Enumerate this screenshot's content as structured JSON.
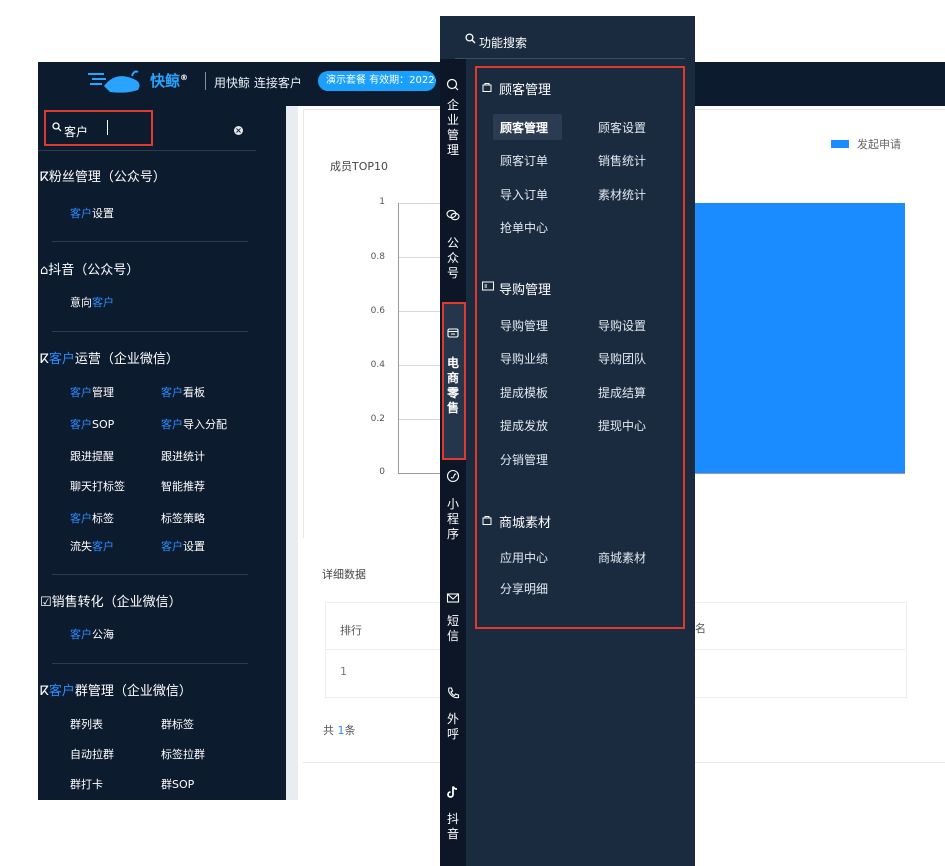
{
  "header": {
    "logo_text": "快鲸",
    "logo_reg": "®",
    "slogan": "用快鲸 连接客户",
    "plan_badge": "演示套餐 有效期：2022-"
  },
  "sidebar": {
    "search": {
      "value_hl": "客户"
    },
    "groups": [
      {
        "title_pre": "粉丝管理（公众号）",
        "items": [
          {
            "pre": "",
            "hl": "客户",
            "post": "设置"
          }
        ]
      },
      {
        "title_pre": "抖音（公众号）",
        "items": [
          {
            "pre": "意向",
            "hl": "客户",
            "post": ""
          }
        ]
      },
      {
        "title_hl": "客户",
        "title_post": "运营（企业微信）",
        "items": [
          {
            "pre": "",
            "hl": "客户",
            "post": "管理"
          },
          {
            "pre": "",
            "hl": "客户",
            "post": "看板"
          },
          {
            "pre": "",
            "hl": "客户",
            "post": "SOP"
          },
          {
            "pre": "",
            "hl": "客户",
            "post": "导入分配"
          },
          {
            "pre": "跟进提醒",
            "hl": "",
            "post": ""
          },
          {
            "pre": "跟进统计",
            "hl": "",
            "post": ""
          },
          {
            "pre": "聊天打标签",
            "hl": "",
            "post": ""
          },
          {
            "pre": "智能推荐",
            "hl": "",
            "post": ""
          },
          {
            "pre": "",
            "hl": "客户",
            "post": "标签"
          },
          {
            "pre": "标签策略",
            "hl": "",
            "post": ""
          },
          {
            "pre": "流失",
            "hl": "客户",
            "post": ""
          },
          {
            "pre": "",
            "hl": "客户",
            "post": "设置"
          }
        ]
      },
      {
        "title_pre": "销售转化（企业微信）",
        "items": [
          {
            "pre": "",
            "hl": "客户",
            "post": "公海"
          }
        ]
      },
      {
        "title_hl": "客户",
        "title_post": "群管理（企业微信）",
        "items": [
          {
            "pre": "群列表",
            "hl": "",
            "post": ""
          },
          {
            "pre": "群标签",
            "hl": "",
            "post": ""
          },
          {
            "pre": "自动拉群",
            "hl": "",
            "post": ""
          },
          {
            "pre": "标签拉群",
            "hl": "",
            "post": ""
          },
          {
            "pre": "群打卡",
            "hl": "",
            "post": ""
          },
          {
            "pre": "群SOP",
            "hl": "",
            "post": ""
          }
        ]
      }
    ]
  },
  "chart_data": {
    "type": "bar",
    "title": "成员TOP10",
    "yticks": [
      "1",
      "0.8",
      "0.6",
      "0.4",
      "0.2",
      "0"
    ],
    "ylim": [
      0,
      1
    ],
    "series": [
      {
        "name": "发起申请",
        "values": [
          1
        ]
      }
    ],
    "legend_position": "top-right",
    "color": "#1a8cff"
  },
  "detail": {
    "title": "详细数据",
    "col_rank": "排行",
    "col_name_partial": "名",
    "row_rank": "1",
    "total_pre": "共 ",
    "total_num": "1",
    "total_post": "条"
  },
  "overlay": {
    "search_placeholder": "功能搜索",
    "rail": [
      {
        "icon": "chat-icon",
        "label": "企\n业\n管\n理"
      },
      {
        "icon": "wechat-icon",
        "label": "公\n众\n号"
      },
      {
        "icon": "shop-icon",
        "label": "电\n商\n零\n售"
      },
      {
        "icon": "miniprogram-icon",
        "label": "小\n程\n序"
      },
      {
        "icon": "mail-icon",
        "label": "短\n信"
      },
      {
        "icon": "phone-icon",
        "label": "外\n呼"
      },
      {
        "icon": "tiktok-icon",
        "label": "抖\n音"
      }
    ],
    "sections": [
      {
        "title": "顾客管理",
        "icon": "bag-icon",
        "items": [
          "顾客管理",
          "顾客设置",
          "顾客订单",
          "销售统计",
          "导入订单",
          "素材统计",
          "抢单中心"
        ]
      },
      {
        "title": "导购管理",
        "icon": "idcard-icon",
        "items": [
          "导购管理",
          "导购设置",
          "导购业绩",
          "导购团队",
          "提成模板",
          "提成结算",
          "提成发放",
          "提现中心",
          "分销管理"
        ]
      },
      {
        "title": "商城素材",
        "icon": "bag-icon",
        "items": [
          "应用中心",
          "商城素材",
          "分享明细"
        ]
      }
    ]
  },
  "colors": {
    "sidebar_bg": "#0d1b2f",
    "overlay_bg": "#1a2a3f",
    "accent": "#1a8cff",
    "highlight_border": "#e03a2f"
  }
}
